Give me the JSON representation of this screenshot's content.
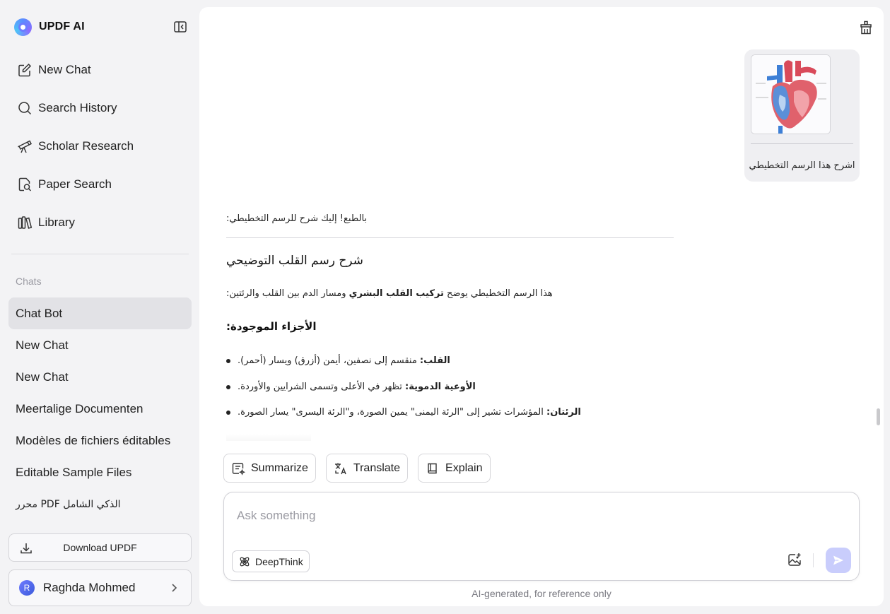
{
  "app": {
    "name": "UPDF AI"
  },
  "sidebar": {
    "nav": [
      {
        "label": "New Chat",
        "icon": "edit-icon"
      },
      {
        "label": "Search History",
        "icon": "search-icon"
      },
      {
        "label": "Scholar Research",
        "icon": "telescope-icon"
      },
      {
        "label": "Paper Search",
        "icon": "document-search-icon"
      },
      {
        "label": "Library",
        "icon": "library-icon"
      }
    ],
    "chats_label": "Chats",
    "chats": [
      "Chat Bot",
      "New Chat",
      "New Chat",
      "Meertalige Documenten",
      "Modèles de fichiers éditables",
      "Editable Sample Files",
      "محرر PDF الذكي الشامل"
    ],
    "active_chat_index": 0,
    "download_label": "Download UPDF",
    "user": {
      "initial": "R",
      "name": "Raghda Mohmed"
    }
  },
  "conversation": {
    "user_message": {
      "text": "اشرح هذا الرسم التخطيطي",
      "image": "heart-diagram-thumbnail"
    },
    "answer": {
      "intro": "بالطبع! إليك شرح للرسم التخطيطي:",
      "heading": "شرح رسم القلب التوضيحي",
      "paragraph_before": "هذا الرسم التخطيطي يوضح ",
      "paragraph_bold": "تركيب القلب البشري",
      "paragraph_after": " ومسار الدم بين القلب والرئتين:",
      "subheading": "الأجزاء الموجودة:",
      "items": [
        {
          "bold": "القلب:",
          "text": " منقسم إلى نصفين، أيمن (أزرق) ويسار (أحمر)."
        },
        {
          "bold": "الأوعية الدموية:",
          "text": " تظهر في الأعلى وتسمى الشرايين والأوردة."
        },
        {
          "bold": "الرئتان:",
          "text": " المؤشرات تشير إلى \"الرئة اليمنى\" يمين الصورة، و\"الرئة اليسرى\" يسار الصورة."
        }
      ]
    }
  },
  "quick_actions": [
    {
      "label": "Summarize",
      "icon": "summarize-icon"
    },
    {
      "label": "Translate",
      "icon": "translate-icon"
    },
    {
      "label": "Explain",
      "icon": "book-icon"
    }
  ],
  "composer": {
    "placeholder": "Ask something",
    "value": "",
    "deepthink_label": "DeepThink"
  },
  "disclaimer": "AI-generated, for reference only",
  "colors": {
    "accent": "#6f7bff",
    "send_disabled": "#c9cdfc",
    "active_chat_bg": "#e2e2e6"
  }
}
